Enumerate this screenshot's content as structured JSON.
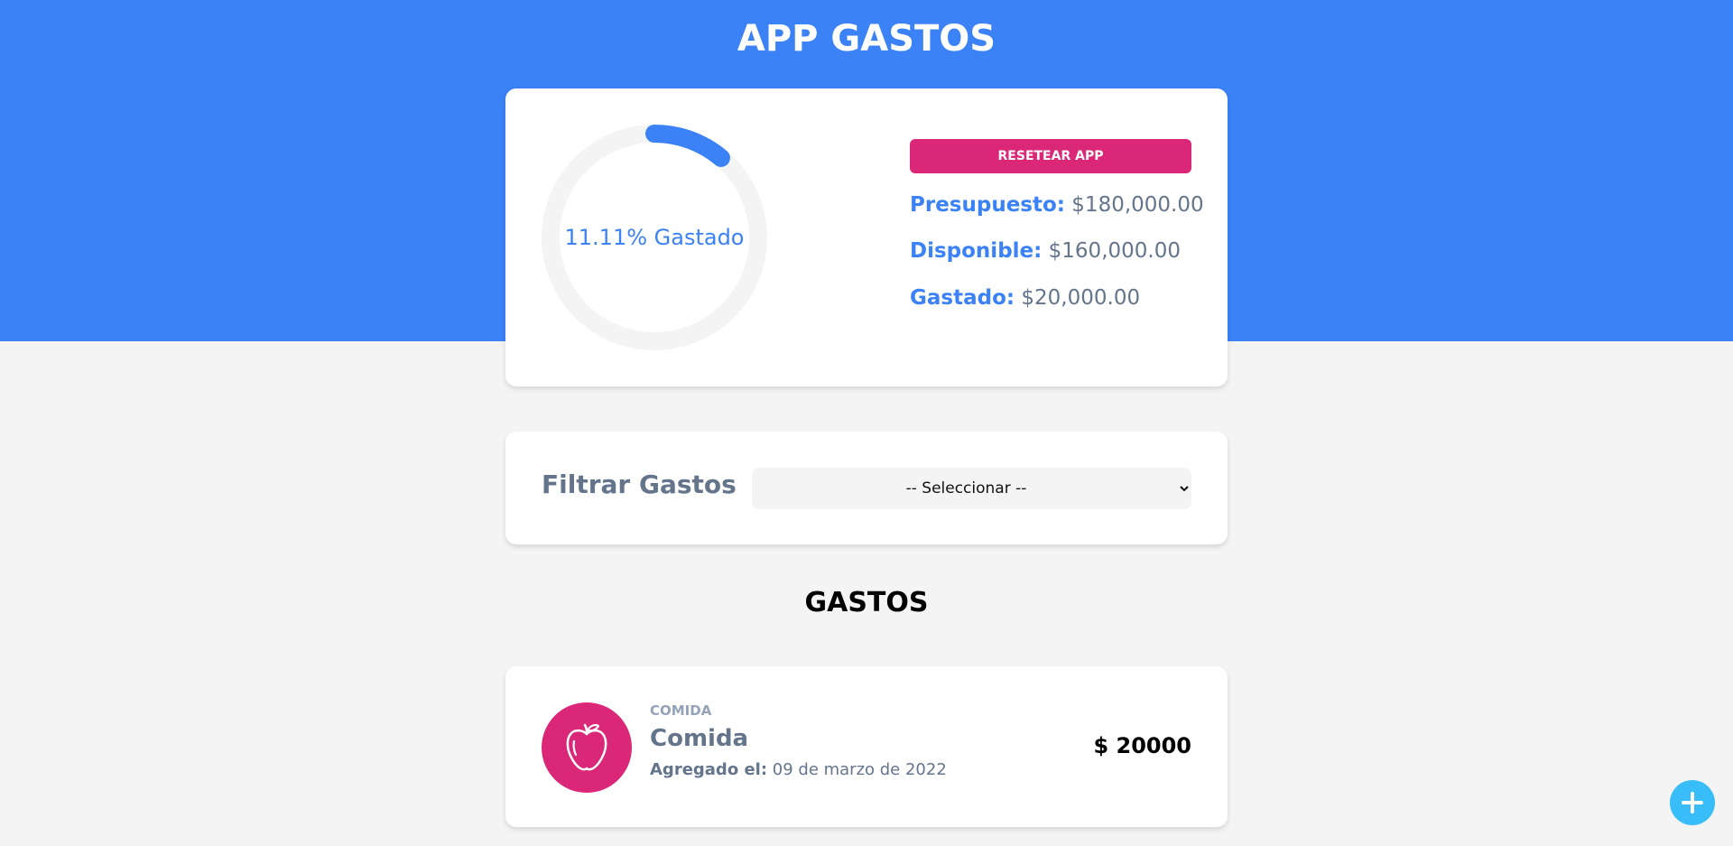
{
  "header": {
    "title": "APP GASTOS",
    "background_color": "#3b82f6"
  },
  "budget": {
    "progress_percent": 11.11,
    "progress_text": "11.11% Gastado",
    "reset_label": "RESETEAR APP",
    "presupuesto_label": "Presupuesto:",
    "presupuesto_value": "$180,000.00",
    "disponible_label": "Disponible:",
    "disponible_value": "$160,000.00",
    "gastado_label": "Gastado:",
    "gastado_value": "$20,000.00",
    "accent_color": "#3b82f6",
    "reset_color": "#db2777"
  },
  "filter": {
    "label": "Filtrar Gastos",
    "selected": "-- Seleccionar --"
  },
  "expenses": {
    "title": "GASTOS",
    "items": [
      {
        "category": "COMIDA",
        "name": "Comida",
        "date_label": "Agregado el:",
        "date": "09 de marzo de 2022",
        "amount": "$ 20000",
        "icon": "apple-icon",
        "icon_color": "#db2777"
      }
    ]
  },
  "fab": {
    "icon": "plus-icon",
    "color": "#38bdf8"
  }
}
